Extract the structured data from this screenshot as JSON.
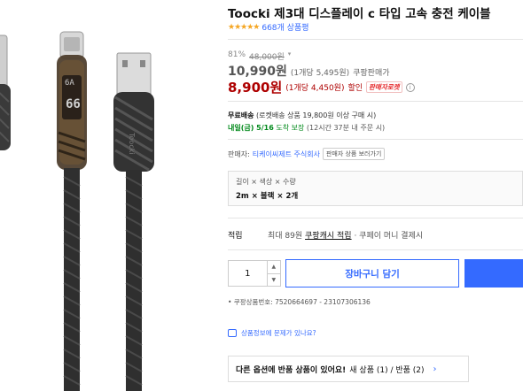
{
  "product": {
    "title": "Toocki 제3대 디스플레이 c 타입 고속 충전 케이블",
    "stars": "★★★★★",
    "review_count": "668개 상품평"
  },
  "pricing": {
    "discount_rate": "81%",
    "original_price": "48,000원",
    "sale_price": "10,990원",
    "sale_unit": "(1개당 5,495원)",
    "seller_type": "쿠팡판매가",
    "coupang_price": "8,900원",
    "coupang_unit": "(1개당 4,450원)",
    "discount_label": "할인",
    "rocket_badge": "판매자로켓"
  },
  "shipping": {
    "free_label": "무료배송",
    "free_detail": "(로켓배송 상품 19,800원 이상 구매 시)",
    "arrival_label": "내일(금) 5/16",
    "arrival_suffix": "도착 보장",
    "arrival_detail": "(12시간 37분 내 주문 시)"
  },
  "seller": {
    "label": "판매자:",
    "name": "티케이씨제트 주식회사",
    "more_button": "판매자 상품 보러가기"
  },
  "options": {
    "header": "길이 × 색상 × 수량",
    "value": "2m × 블랙 × 2개"
  },
  "reward": {
    "label": "적립",
    "text_prefix": "최대 89원",
    "link": "쿠팡캐시 적립",
    "text_suffix": "· 쿠페이 머니 결제시"
  },
  "purchase": {
    "quantity": "1",
    "up_arrow": "▲",
    "down_arrow": "▼",
    "cart_button": "장바구니 담기"
  },
  "product_no": "• 쿠팡상품번호: 7520664697 - 23107306136",
  "report_link": "상품정보에 문제가 있나요?",
  "other_options": {
    "bold_text": "다른 옵션에 반품 상품이 있어요!",
    "new_text": "새 상품 (1) / 반품 (2)",
    "chevron": "›"
  },
  "image": {
    "display_text": "6A",
    "display_number": "66",
    "cable_label": "Toocki"
  },
  "colors": {
    "accent_blue": "#346aff",
    "price_red": "#ae0000",
    "star_orange": "#f5a623",
    "delivery_green": "#00891a"
  }
}
